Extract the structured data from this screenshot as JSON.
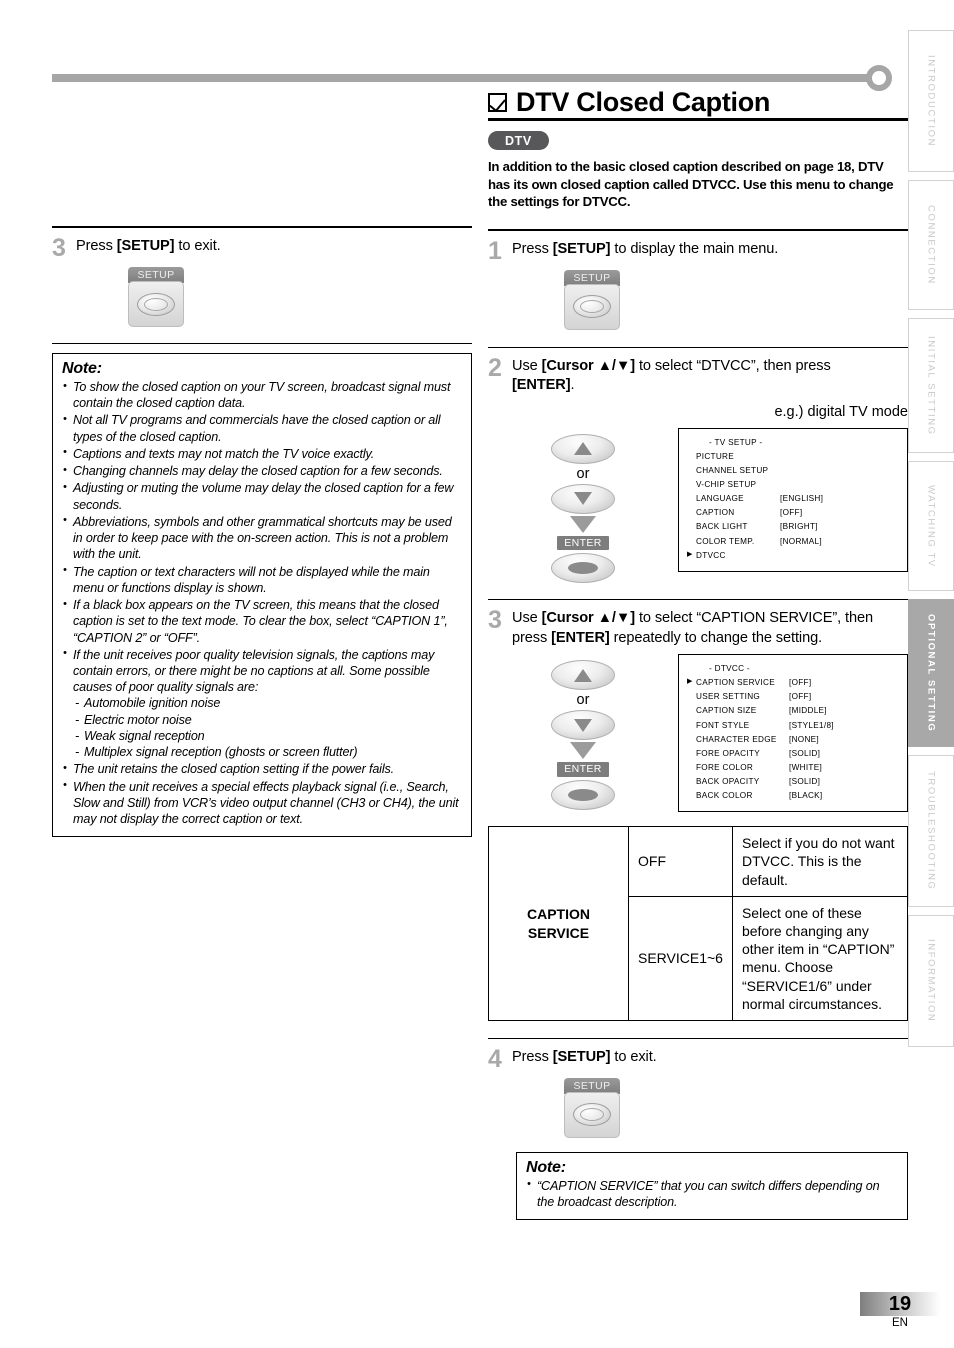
{
  "sidebar": {
    "tabs": [
      {
        "label": "INTRODUCTION",
        "active": false
      },
      {
        "label": "CONNECTION",
        "active": false
      },
      {
        "label": "INITIAL  SETTING",
        "active": false
      },
      {
        "label": "WATCHING  TV",
        "active": false
      },
      {
        "label": "OPTIONAL  SETTING",
        "active": true
      },
      {
        "label": "TROUBLESHOOTING",
        "active": false
      },
      {
        "label": "INFORMATION",
        "active": false
      }
    ],
    "active_color": "#a8a8a8",
    "inactive_color": "#c9c9c9"
  },
  "left_column": {
    "step3": {
      "number": "3",
      "text_pre": "Press ",
      "text_bold": "[SETUP]",
      "text_post": " to exit.",
      "key_label": "SETUP"
    },
    "note": {
      "heading": "Note:",
      "items": [
        {
          "type": "bullet",
          "text": "To show the closed caption on your TV screen, broadcast signal must contain the closed caption data."
        },
        {
          "type": "bullet",
          "text": "Not all TV programs and commercials have the closed caption or all types of the closed caption."
        },
        {
          "type": "bullet",
          "text": "Captions and texts may not match the TV voice exactly."
        },
        {
          "type": "bullet",
          "text": "Changing channels may delay the closed caption for a few seconds."
        },
        {
          "type": "bullet",
          "text": "Adjusting or muting the volume may delay the closed caption for a few seconds."
        },
        {
          "type": "bullet",
          "text": "Abbreviations, symbols and other grammatical shortcuts may be used in order to keep pace with the on-screen action. This is not a problem with the unit."
        },
        {
          "type": "bullet",
          "text": "The caption or text characters will not be displayed while the main menu or functions display is shown."
        },
        {
          "type": "bullet",
          "text": "If a black box appears on the TV screen, this means that the closed caption is set to the text mode. To clear the box, select “CAPTION 1”, “CAPTION 2” or “OFF”."
        },
        {
          "type": "bullet",
          "text": "If the unit receives poor quality television signals, the captions may contain errors, or there might be no captions at all. Some possible causes of poor quality signals are:"
        },
        {
          "type": "sub",
          "text": "Automobile ignition noise"
        },
        {
          "type": "sub",
          "text": "Electric motor noise"
        },
        {
          "type": "sub",
          "text": "Weak signal reception"
        },
        {
          "type": "sub",
          "text": "Multiplex signal reception (ghosts or screen flutter)"
        },
        {
          "type": "bullet",
          "text": "The unit retains the closed caption setting if the power fails."
        },
        {
          "type": "bullet",
          "text": "When the unit receives a special effects playback signal (i.e., Search, Slow and Still) from VCR’s video output channel (CH3 or CH4), the unit may not display the correct caption or text."
        }
      ]
    }
  },
  "right_column": {
    "heading": {
      "checkbox_icon": "checked-box-icon",
      "title": "DTV Closed Caption",
      "badge": "DTV",
      "intro": "In addition to the basic closed caption described on page 18, DTV has its own closed caption called DTVCC. Use this menu to change the settings for DTVCC."
    },
    "step1": {
      "number": "1",
      "text_pre": "Press ",
      "text_bold": "[SETUP]",
      "text_post": " to display the main menu.",
      "key_label": "SETUP"
    },
    "step2": {
      "number": "2",
      "line1_pre": "Use ",
      "line1_bold": "[Cursor ▲/▼]",
      "line1_post": " to select “DTVCC”, then press",
      "line2_bold": "[ENTER]",
      "line2_post": ".",
      "or_label": "or",
      "enter_label": "ENTER",
      "caption": "e.g.) digital TV mode",
      "osd": {
        "title": "-  TV SETUP  -",
        "rows": [
          {
            "marker": "",
            "name": "PICTURE",
            "value": ""
          },
          {
            "marker": "",
            "name": "CHANNEL SETUP",
            "value": ""
          },
          {
            "marker": "",
            "name": "V-CHIP  SETUP",
            "value": ""
          },
          {
            "marker": "",
            "name": "LANGUAGE",
            "value": "[ENGLISH]"
          },
          {
            "marker": "",
            "name": "CAPTION",
            "value": "[OFF]"
          },
          {
            "marker": "",
            "name": "BACK  LIGHT",
            "value": "[BRIGHT]"
          },
          {
            "marker": "",
            "name": "COLOR  TEMP.",
            "value": "[NORMAL]"
          },
          {
            "marker": "▶",
            "name": "DTVCC",
            "value": ""
          }
        ]
      }
    },
    "step3": {
      "number": "3",
      "line1_pre": "Use ",
      "line1_bold": "[Cursor ▲/▼]",
      "line1_post": " to select “CAPTION SERVICE”, then",
      "line2_pre": "press ",
      "line2_bold": "[ENTER]",
      "line2_post": " repeatedly to change the setting.",
      "or_label": "or",
      "enter_label": "ENTER",
      "osd": {
        "title": "- DTVCC -",
        "rows": [
          {
            "marker": "▶",
            "name": "CAPTION SERVICE",
            "value": "[OFF]"
          },
          {
            "marker": "",
            "name": "USER SETTING",
            "value": "[OFF]"
          },
          {
            "marker": "",
            "name": "CAPTION SIZE",
            "value": "[MIDDLE]"
          },
          {
            "marker": "",
            "name": "FONT STYLE",
            "value": "[STYLE1/8]"
          },
          {
            "marker": "",
            "name": "CHARACTER EDGE",
            "value": "[NONE]"
          },
          {
            "marker": "",
            "name": "FORE OPACITY",
            "value": "[SOLID]"
          },
          {
            "marker": "",
            "name": "FORE COLOR",
            "value": "[WHITE]"
          },
          {
            "marker": "",
            "name": "BACK OPACITY",
            "value": "[SOLID]"
          },
          {
            "marker": "",
            "name": "BACK COLOR",
            "value": "[BLACK]"
          }
        ]
      }
    },
    "caption_service_table": {
      "row_header": "CAPTION SERVICE",
      "rows": [
        {
          "option": "OFF",
          "description": "Select if you do not want DTVCC. This is the default."
        },
        {
          "option": "SERVICE1~6",
          "description": "Select one of these before changing any other item in “CAPTION” menu. Choose “SERVICE1/6” under normal circumstances."
        }
      ]
    },
    "step4": {
      "number": "4",
      "text_pre": "Press ",
      "text_bold": "[SETUP]",
      "text_post": " to exit.",
      "key_label": "SETUP"
    },
    "note": {
      "heading": "Note:",
      "items": [
        {
          "type": "bullet",
          "text": "“CAPTION SERVICE” that you can switch differs depending on the broadcast description."
        }
      ]
    }
  },
  "footer": {
    "page_number": "19",
    "language_code": "EN"
  }
}
